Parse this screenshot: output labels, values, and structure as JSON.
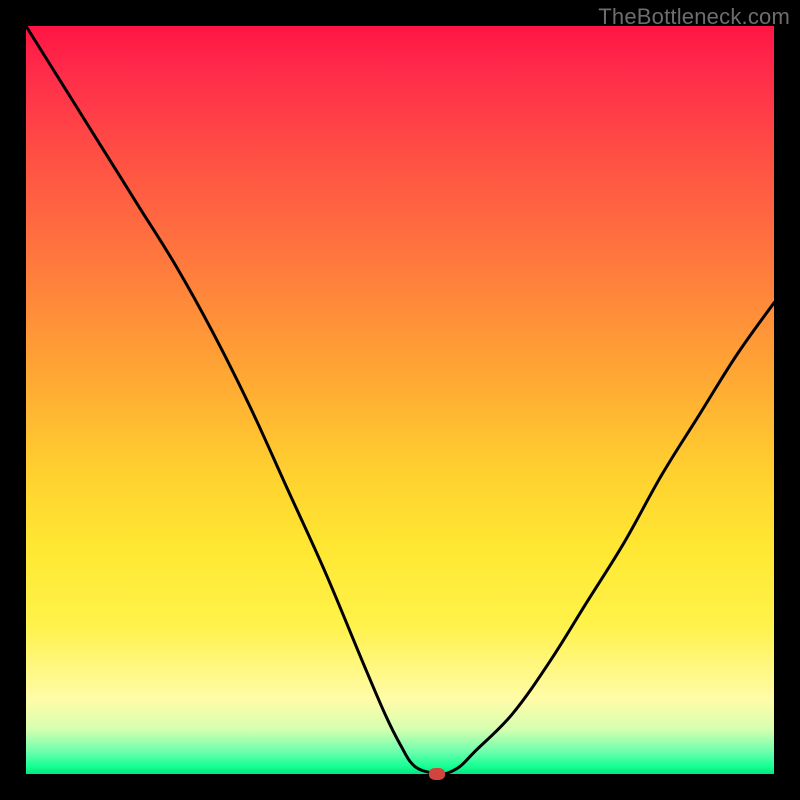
{
  "watermark": "TheBottleneck.com",
  "chart_data": {
    "type": "line",
    "title": "",
    "xlabel": "",
    "ylabel": "",
    "xlim": [
      0,
      100
    ],
    "ylim": [
      0,
      100
    ],
    "x": [
      0,
      5,
      10,
      15,
      20,
      25,
      30,
      35,
      40,
      45,
      48,
      50,
      52,
      55,
      56,
      58,
      60,
      65,
      70,
      75,
      80,
      85,
      90,
      95,
      100
    ],
    "values": [
      100,
      92,
      84,
      76,
      68,
      59,
      49,
      38,
      27,
      15,
      8,
      4,
      1,
      0,
      0,
      1,
      3,
      8,
      15,
      23,
      31,
      40,
      48,
      56,
      63
    ],
    "marker": {
      "x": 55,
      "y": 0
    },
    "colors": {
      "gradient_top": "#ff1544",
      "gradient_mid_upper": "#ff7a3d",
      "gradient_mid": "#ffd12f",
      "gradient_mid_lower": "#fffca8",
      "gradient_bottom": "#14ff94",
      "curve": "#000000",
      "marker": "#d1453e",
      "frame": "#000000"
    }
  }
}
